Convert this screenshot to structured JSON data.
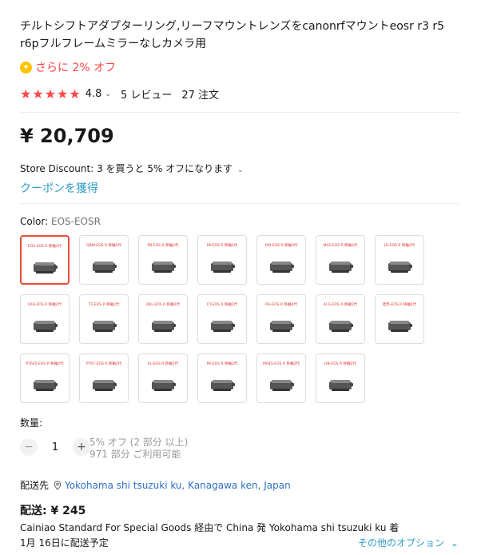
{
  "product": {
    "title": "チルトシフトアダプターリング,リーフマウントレンズをcanonrfマウントeosr r3 r5 r6pフルフレームミラーなしカメラ用",
    "promo": "さらに 2% オフ",
    "rating": "4.8",
    "reviews": "5 レビュー",
    "orders": "27 注文",
    "price": "¥ 20,709",
    "store_discount": "Store Discount: 3 を買うと 5% オフになります",
    "coupon": "クーポンを獲得"
  },
  "color": {
    "label": "Color: ",
    "value": "EOS-EOSR",
    "options": [
      "EOS-EOS R 移軸2代",
      "QBM-EOS R 移軸2代",
      "PB-EOS R 移軸2代",
      "PK-EOS R 移軸2代",
      "OM-EOS R 移軸2代",
      "M42-EOS R 移軸2代",
      "LR-EOS R 移軸2代",
      "EXA-EOS R 移軸2代",
      "T2-EOS R 移軸2代",
      "DKL-EOS R 移軸2代",
      "CY-EOS R 移軸2代",
      "RH-EOS R 移軸2代",
      "AI G-EOS R 移軸2代",
      "哈苏-EOS R 移軸2代",
      "PT645-EOS R 移軸2代",
      "PT67-EOS R 移軸2代",
      "PL-EOS R 移軸2代",
      "P6-EOS R 移軸2代",
      "M645-EOS R 移軸2代",
      "HB-EOS R 移軸2代"
    ]
  },
  "quantity": {
    "label": "数量:",
    "value": "1",
    "minus": "−",
    "plus": "+",
    "discount_note": "5% オフ (2 部分 以上)",
    "available": "971 部分 ご利用可能"
  },
  "shipping": {
    "to_label": "配送先",
    "address": "Yokohama shi tsuzuki ku, Kanagawa ken, Japan",
    "fee": "配送: ¥ 245",
    "method": "Cainiao Standard For Special Goods 経由で China 発 Yokohama shi tsuzuki ku 着",
    "date": "1月 16日に配送予定",
    "other_options": "その他のオプション"
  },
  "colors": {
    "accent_red": "#ff4747",
    "link_blue": "#2e70c3",
    "coupon_blue": "#2e9cc3",
    "star_yellow": "#ffc400"
  }
}
